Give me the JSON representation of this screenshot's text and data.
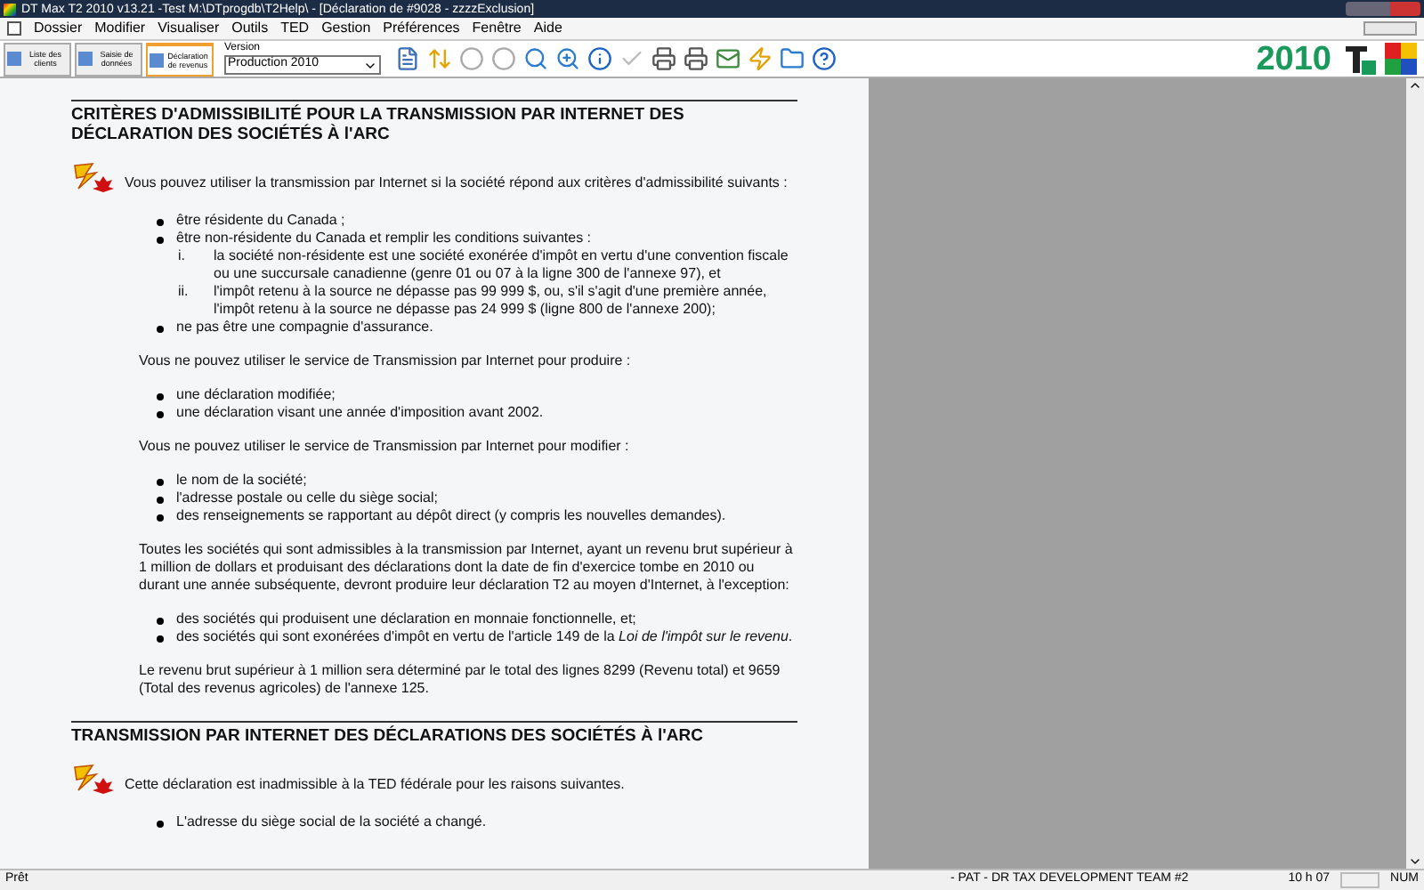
{
  "window": {
    "title": "DT Max T2 2010 v13.21 -Test  M:\\DTprogdb\\T2Help\\ - [Déclaration de #9028 - zzzzExclusion]"
  },
  "menu": [
    "Dossier",
    "Modifier",
    "Visualiser",
    "Outils",
    "TED",
    "Gestion",
    "Préférences",
    "Fenêtre",
    "Aide"
  ],
  "view_tabs": [
    {
      "label": "Liste des clients",
      "selected": false
    },
    {
      "label": "Saisie de données",
      "selected": false
    },
    {
      "label": "Déclaration de revenus",
      "selected": true
    }
  ],
  "version": {
    "label": "Version",
    "value": "Production 2010"
  },
  "brand": {
    "year": "2010"
  },
  "sections": [
    {
      "title": "CRITÈRES D'ADMISSIBILITÉ POUR LA TRANSMISSION PAR INTERNET DES DÉCLARATION DES SOCIÉTÉS À l'ARC",
      "blocks": [
        {
          "kind": "intro",
          "text": "Vous pouvez utiliser la transmission par Internet si la société répond aux critères d'admissibilité suivants :"
        },
        {
          "kind": "list",
          "items": [
            {
              "text": "être résidente du Canada ;"
            },
            {
              "text": "être non-résidente du Canada et remplir les conditions suivantes :",
              "children": [
                {
                  "marker": "i.",
                  "text": "la société non-résidente est une société exonérée d'impôt en vertu d'une convention fiscale ou une succursale canadienne (genre 01 ou 07 à la ligne 300 de l'annexe 97), et"
                },
                {
                  "marker": "ii.",
                  "text": "l'impôt retenu à la source ne dépasse pas 99 999 $, ou, s'il s'agit d'une première année, l'impôt retenu à la source ne dépasse pas 24 999 $ (ligne 800 de l'annexe 200);"
                }
              ]
            },
            {
              "text": "ne pas être une compagnie d'assurance."
            }
          ]
        },
        {
          "kind": "para",
          "text": "Vous ne pouvez utiliser le service de Transmission par Internet pour produire :"
        },
        {
          "kind": "list",
          "items": [
            {
              "text": "une déclaration modifiée;"
            },
            {
              "text": "une déclaration visant une année d'imposition avant 2002."
            }
          ]
        },
        {
          "kind": "para",
          "text": "Vous ne pouvez utiliser le service de Transmission par Internet pour modifier :"
        },
        {
          "kind": "list",
          "items": [
            {
              "text": "le nom de la société;"
            },
            {
              "text": "l'adresse postale ou celle du siège social;"
            },
            {
              "text": "des renseignements se rapportant au dépôt direct (y compris les nouvelles demandes)."
            }
          ]
        },
        {
          "kind": "para",
          "text": "Toutes les sociétés qui sont admissibles à la transmission par Internet, ayant un revenu brut supérieur à 1 million de dollars et produisant des déclarations dont la date de fin d'exercice tombe en 2010 ou durant une année subséquente, devront produire leur déclaration T2 au moyen d'Internet, à l'exception:"
        },
        {
          "kind": "list",
          "items": [
            {
              "text": "des sociétés qui produisent une déclaration en monnaie fonctionnelle, et;"
            },
            {
              "text": "des sociétés qui sont exonérées d'impôt en vertu de l'article 149 de la *Loi de l'impôt sur le revenu*."
            }
          ]
        },
        {
          "kind": "para",
          "text": "Le revenu brut supérieur à 1 million sera déterminé par le total des lignes 8299 (Revenu total) et 9659 (Total des revenus agricoles) de l'annexe 125."
        }
      ]
    },
    {
      "title": "TRANSMISSION PAR INTERNET DES DÉCLARATIONS DES SOCIÉTÉS À l'ARC",
      "blocks": [
        {
          "kind": "intro",
          "text": "Cette déclaration est inadmissible à la TED fédérale pour les raisons suivantes."
        },
        {
          "kind": "list",
          "items": [
            {
              "text": "L'adresse du siège social de la société a changé."
            }
          ]
        }
      ]
    }
  ],
  "status_bar": {
    "state": "Prêt",
    "user": "- PAT - DR TAX DEVELOPMENT TEAM #2",
    "time": "10 h 07",
    "mode": "NUM"
  }
}
